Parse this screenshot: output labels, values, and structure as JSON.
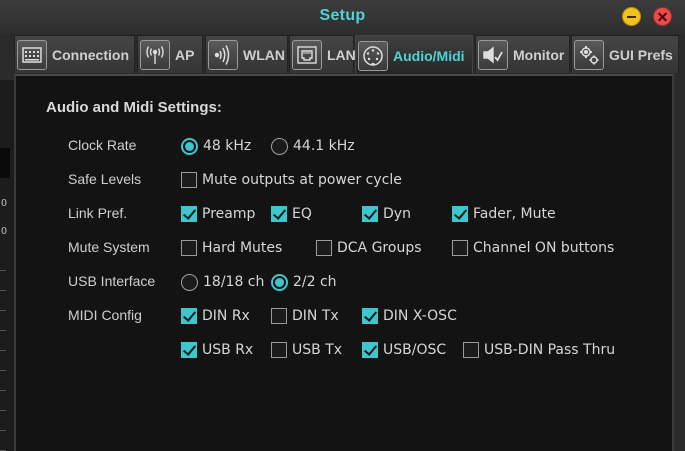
{
  "window": {
    "title": "Setup"
  },
  "background_strip": {
    "labels": [
      "O",
      "O"
    ]
  },
  "tabs": [
    {
      "id": "connection",
      "label": "Connection",
      "icon": "connection-icon",
      "active": false
    },
    {
      "id": "ap",
      "label": "AP",
      "icon": "antenna-icon",
      "active": false
    },
    {
      "id": "wlan",
      "label": "WLAN",
      "icon": "wifi-icon",
      "active": false
    },
    {
      "id": "lan",
      "label": "LAN",
      "icon": "ethernet-port-icon",
      "active": false
    },
    {
      "id": "audio_midi",
      "label": "Audio/Midi",
      "icon": "midi-din-icon",
      "active": true
    },
    {
      "id": "monitor",
      "label": "Monitor",
      "icon": "speaker-monitor-icon",
      "active": false
    },
    {
      "id": "gui_prefs",
      "label": "GUI Prefs",
      "icon": "gears-icon",
      "active": false
    }
  ],
  "panel": {
    "heading": "Audio and Midi Settings:",
    "rows": {
      "clock_rate": {
        "label": "Clock Rate",
        "options": [
          {
            "label": "48 kHz",
            "selected": true
          },
          {
            "label": "44.1 kHz",
            "selected": false
          }
        ]
      },
      "safe_levels": {
        "label": "Safe Levels",
        "options": [
          {
            "label": "Mute outputs at power cycle",
            "checked": false
          }
        ]
      },
      "link_pref": {
        "label": "Link Pref.",
        "options": [
          {
            "label": "Preamp",
            "checked": true
          },
          {
            "label": "EQ",
            "checked": true
          },
          {
            "label": "Dyn",
            "checked": true
          },
          {
            "label": "Fader, Mute",
            "checked": true
          }
        ]
      },
      "mute_system": {
        "label": "Mute System",
        "options": [
          {
            "label": "Hard Mutes",
            "checked": false
          },
          {
            "label": "DCA Groups",
            "checked": false
          },
          {
            "label": "Channel ON buttons",
            "checked": false
          }
        ]
      },
      "usb_interface": {
        "label": "USB Interface",
        "options": [
          {
            "label": "18/18 ch",
            "selected": false
          },
          {
            "label": "2/2 ch",
            "selected": true
          }
        ]
      },
      "midi_config": {
        "label": "MIDI Config",
        "options": [
          {
            "label": "DIN Rx",
            "checked": true
          },
          {
            "label": "DIN Tx",
            "checked": false
          },
          {
            "label": "DIN X-OSC",
            "checked": true
          },
          {
            "label": "USB Rx",
            "checked": true
          },
          {
            "label": "USB Tx",
            "checked": false
          },
          {
            "label": "USB/OSC",
            "checked": true
          },
          {
            "label": "USB-DIN Pass Thru",
            "checked": false
          }
        ]
      }
    }
  },
  "colors": {
    "accent": "#3ec6cc",
    "title": "#4fd2d8",
    "panel_bg": "#131313",
    "chrome_bg": "#2b2b2b"
  }
}
